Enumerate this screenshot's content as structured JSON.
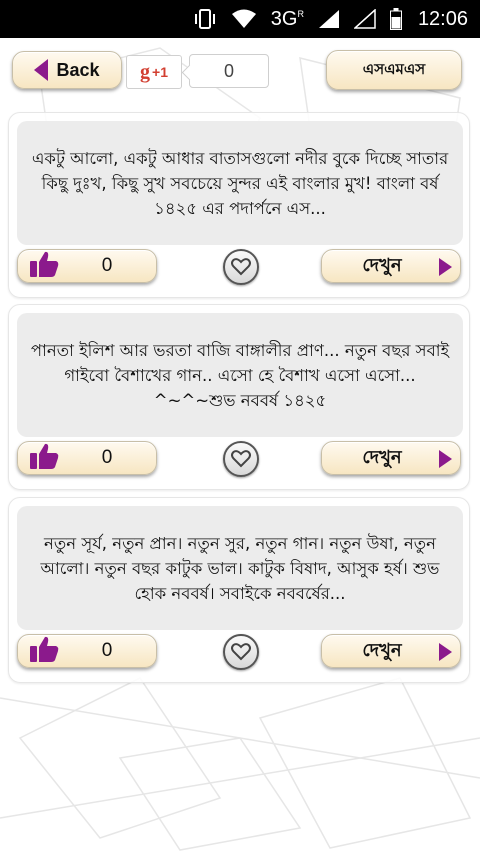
{
  "status_bar": {
    "network": "3G",
    "network_sup": "R",
    "time": "12:06"
  },
  "header": {
    "back_label": "Back",
    "gplus_label": "g",
    "gplus_suffix": "+1",
    "gplus_count": "0",
    "sms_label": "এসএমএস"
  },
  "cards": [
    {
      "text": "একটু আলো, একটু আধার বাতাসগুলো নদীর বুকে দিচ্ছে সাতার কিছু দুঃখ, কিছু সুখ সবচেয়ে সুন্দর এই বাংলার মুখ! বাংলা বর্ষ ১৪২৫ এর পদার্পনে এস...",
      "likes": "0",
      "see_label": "দেখুন"
    },
    {
      "text": "পানতা ইলিশ আর ভরতা বাজি বাঙ্গালীর প্রাণ... নতুন বছর সবাই গাইবো বৈশাখের গান.. এসো হে বৈশাখ এসো এসো... ^~^~শুভ নববর্ষ ১৪২৫",
      "likes": "0",
      "see_label": "দেখুন"
    },
    {
      "text": "নতুন সূর্য, নতুন প্রান। নতুন সুর, নতুন গান। নতুন উষা, নতুন আলো। নতুন বছর কাটুক ভাল। কাটুক বিষাদ, আসুক হর্ষ। শুভ হোক নববর্ষ। সবাইকে নববর্ষের...",
      "likes": "0",
      "see_label": "দেখুন"
    }
  ],
  "colors": {
    "accent": "#8b1a8c",
    "button_bg": "#f7e6c2",
    "card_text_bg": "#ececec"
  },
  "icons": [
    "vibrate-icon",
    "wifi-icon",
    "signal-icon",
    "battery-icon",
    "back-arrow-icon",
    "thumbs-up-icon",
    "heart-icon",
    "play-arrow-icon"
  ]
}
